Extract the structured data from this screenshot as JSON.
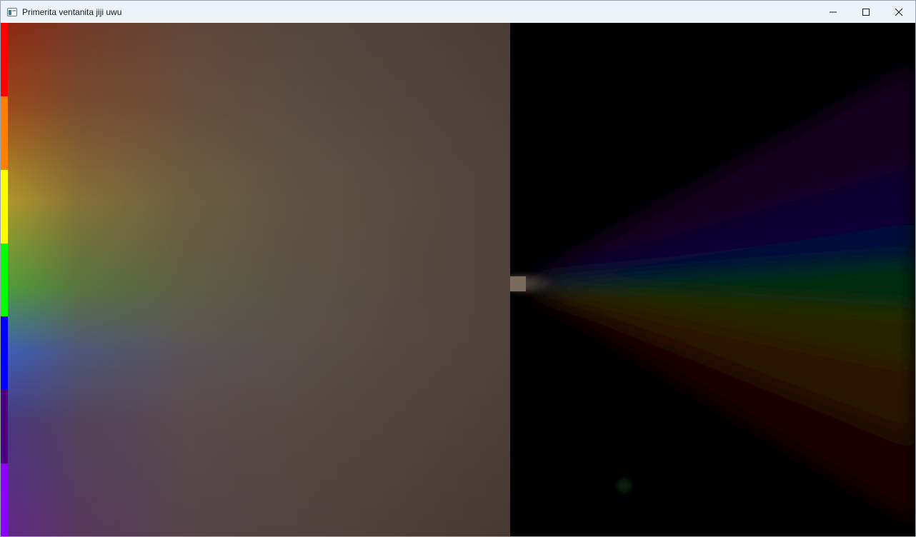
{
  "window": {
    "title": "Primerita ventanita jiji uwu",
    "controls": {
      "minimize_icon": "minimize-icon",
      "maximize_icon": "maximize-icon",
      "close_icon": "close-icon"
    }
  },
  "canvas": {
    "strip_colors": [
      "#ff0000",
      "#ff7f00",
      "#ffff00",
      "#00ff00",
      "#0000ff",
      "#4b0082",
      "#8b00ff"
    ],
    "background_tint": "#5a4a3e",
    "right_background": "#000000",
    "spectrum_colors": [
      "#2a0030",
      "#0a0a3a",
      "#003010",
      "#3a3000",
      "#3a1800",
      "#2a0800"
    ]
  }
}
